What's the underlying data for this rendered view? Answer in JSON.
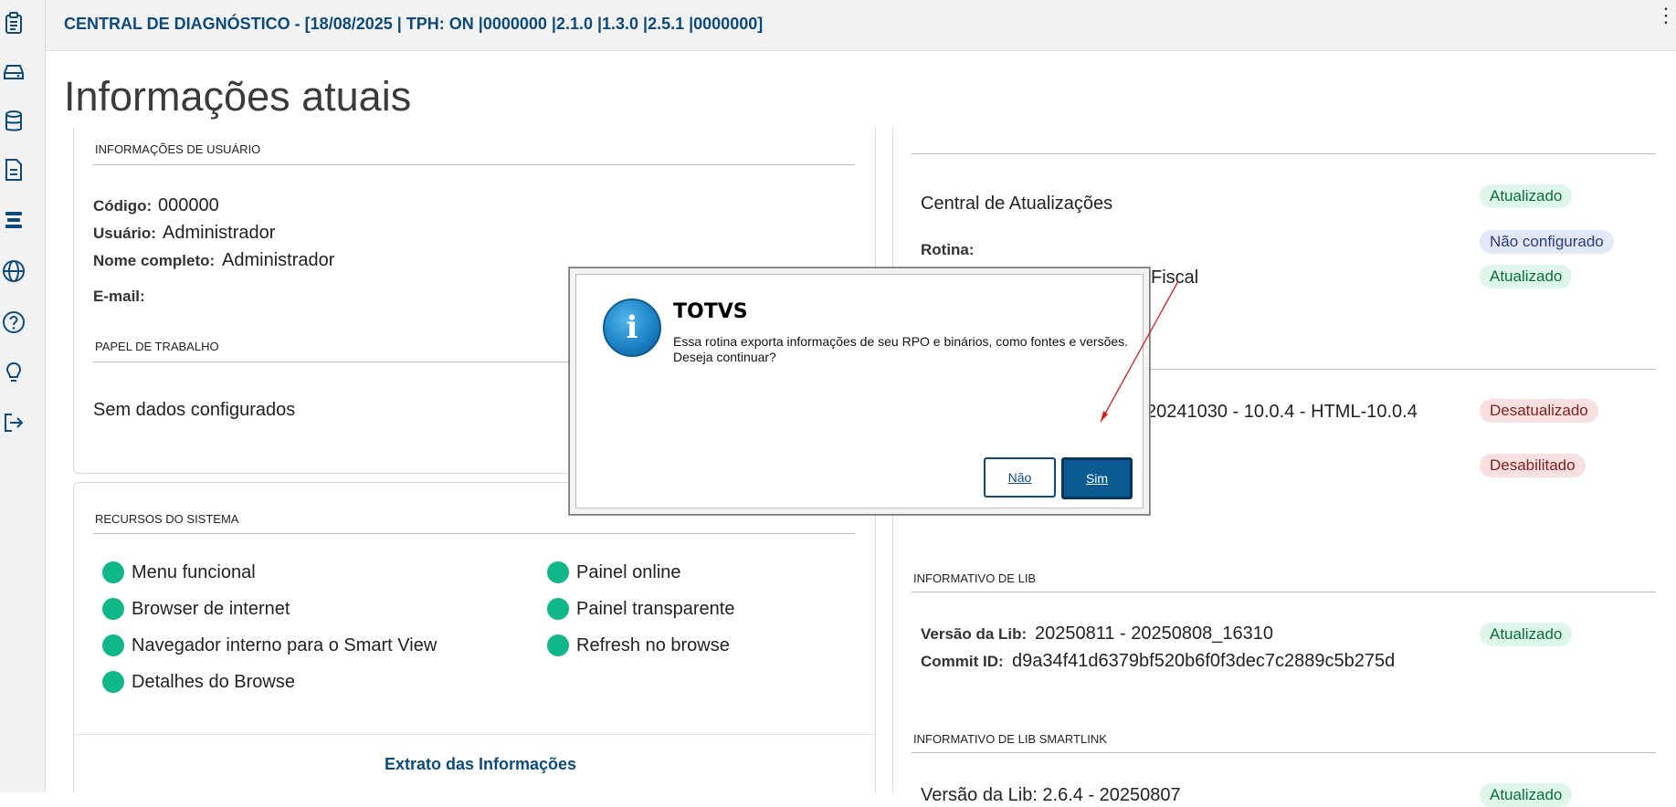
{
  "header": {
    "title": "CENTRAL DE DIAGNÓSTICO - [18/08/2025 | TPH: ON |0000000 |2.1.0 |1.3.0 |2.5.1 |0000000]",
    "menu": "⋮"
  },
  "sidebar": {
    "items": [
      {
        "icon": "clipboard-icon"
      },
      {
        "icon": "hard-drive-icon"
      },
      {
        "icon": "database-icon"
      },
      {
        "icon": "document-icon"
      },
      {
        "icon": "stack-icon"
      },
      {
        "icon": "globe-icon"
      },
      {
        "icon": "help-circle-icon"
      },
      {
        "icon": "lightbulb-icon"
      },
      {
        "icon": "logout-icon"
      }
    ]
  },
  "page_title": "Informações atuais",
  "user_info": {
    "section_title": "INFORMAÇÕES DE USUÁRIO",
    "code_label": "Código:",
    "code_value": "000000",
    "user_label": "Usuário:",
    "user_value": "Administrador",
    "fullname_label": "Nome completo:",
    "fullname_value": "Administrador",
    "email_label": "E-mail:"
  },
  "workpaper": {
    "section_title": "PAPEL DE TRABALHO",
    "empty_text": "Sem dados configurados"
  },
  "resources": {
    "section_title": "RECURSOS DO SISTEMA",
    "items": [
      "Menu funcional",
      "Painel online",
      "Browser de internet",
      "Painel transparente",
      "Navegador interno para o Smart View",
      "Refresh no browse",
      "Detalhes do Browse"
    ],
    "link": "Extrato das Informações"
  },
  "updates": {
    "central_label": "Central de Atualizações",
    "badge_updated": "Atualizado",
    "badge_not_configured": "Não configurado",
    "routine_label": "Rotina:",
    "fiscal_fragment": "Fiscal",
    "badge_updated_2": "Atualizado",
    "version_fragment": "20241030 - 10.0.4 - HTML-10.0.4",
    "badge_outdated": "Desatualizado",
    "badge_disabled": "Desabilitado"
  },
  "lib_info": {
    "section_title": "INFORMATIVO DE LIB",
    "version_label": "Versão da Lib:",
    "version_value": "20250811 - 20250808_16310",
    "commit_label": "Commit ID:",
    "commit_value": "d9a34f41d6379bf520b6f0f3dec7c2889c5b275d",
    "badge": "Atualizado"
  },
  "lib_smartlink": {
    "section_title": "INFORMATIVO DE LIB SMARTLINK",
    "partial_text": "Versão da Lib: 2.6.4 - 20250807",
    "badge": "Atualizado"
  },
  "dialog": {
    "title": "TOTVS",
    "message": "Essa rotina exporta informações de seu RPO e binários, como fontes e versões. Deseja continuar?",
    "no_label": "Não",
    "yes_label": "Sim",
    "icon": "info-icon"
  },
  "colors": {
    "primary": "#0c4b7c",
    "status_green": "#10b78a",
    "annotation_arrow": "#d01f1f"
  }
}
